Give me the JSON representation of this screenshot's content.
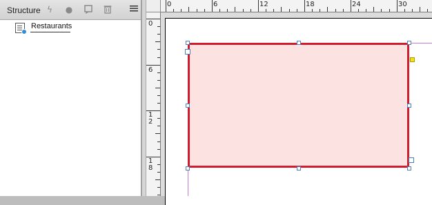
{
  "panel": {
    "title": "Structure",
    "icons": [
      "lightning-icon",
      "record-icon",
      "note-icon",
      "trash-icon",
      "menu-icon"
    ],
    "tree": [
      {
        "label": "Restaurants"
      }
    ]
  },
  "rulers": {
    "horizontal": [
      "0",
      "6",
      "12",
      "18",
      "24",
      "30"
    ],
    "vertical": [
      "0",
      "6",
      "1\n2",
      "1\n8"
    ]
  },
  "colors": {
    "frame_fill": "#fde2e2",
    "frame_stroke": "#d01c2e",
    "handle_border": "#4a7fc4",
    "guide": "#c57bd6",
    "anchor": "#f2e413"
  }
}
